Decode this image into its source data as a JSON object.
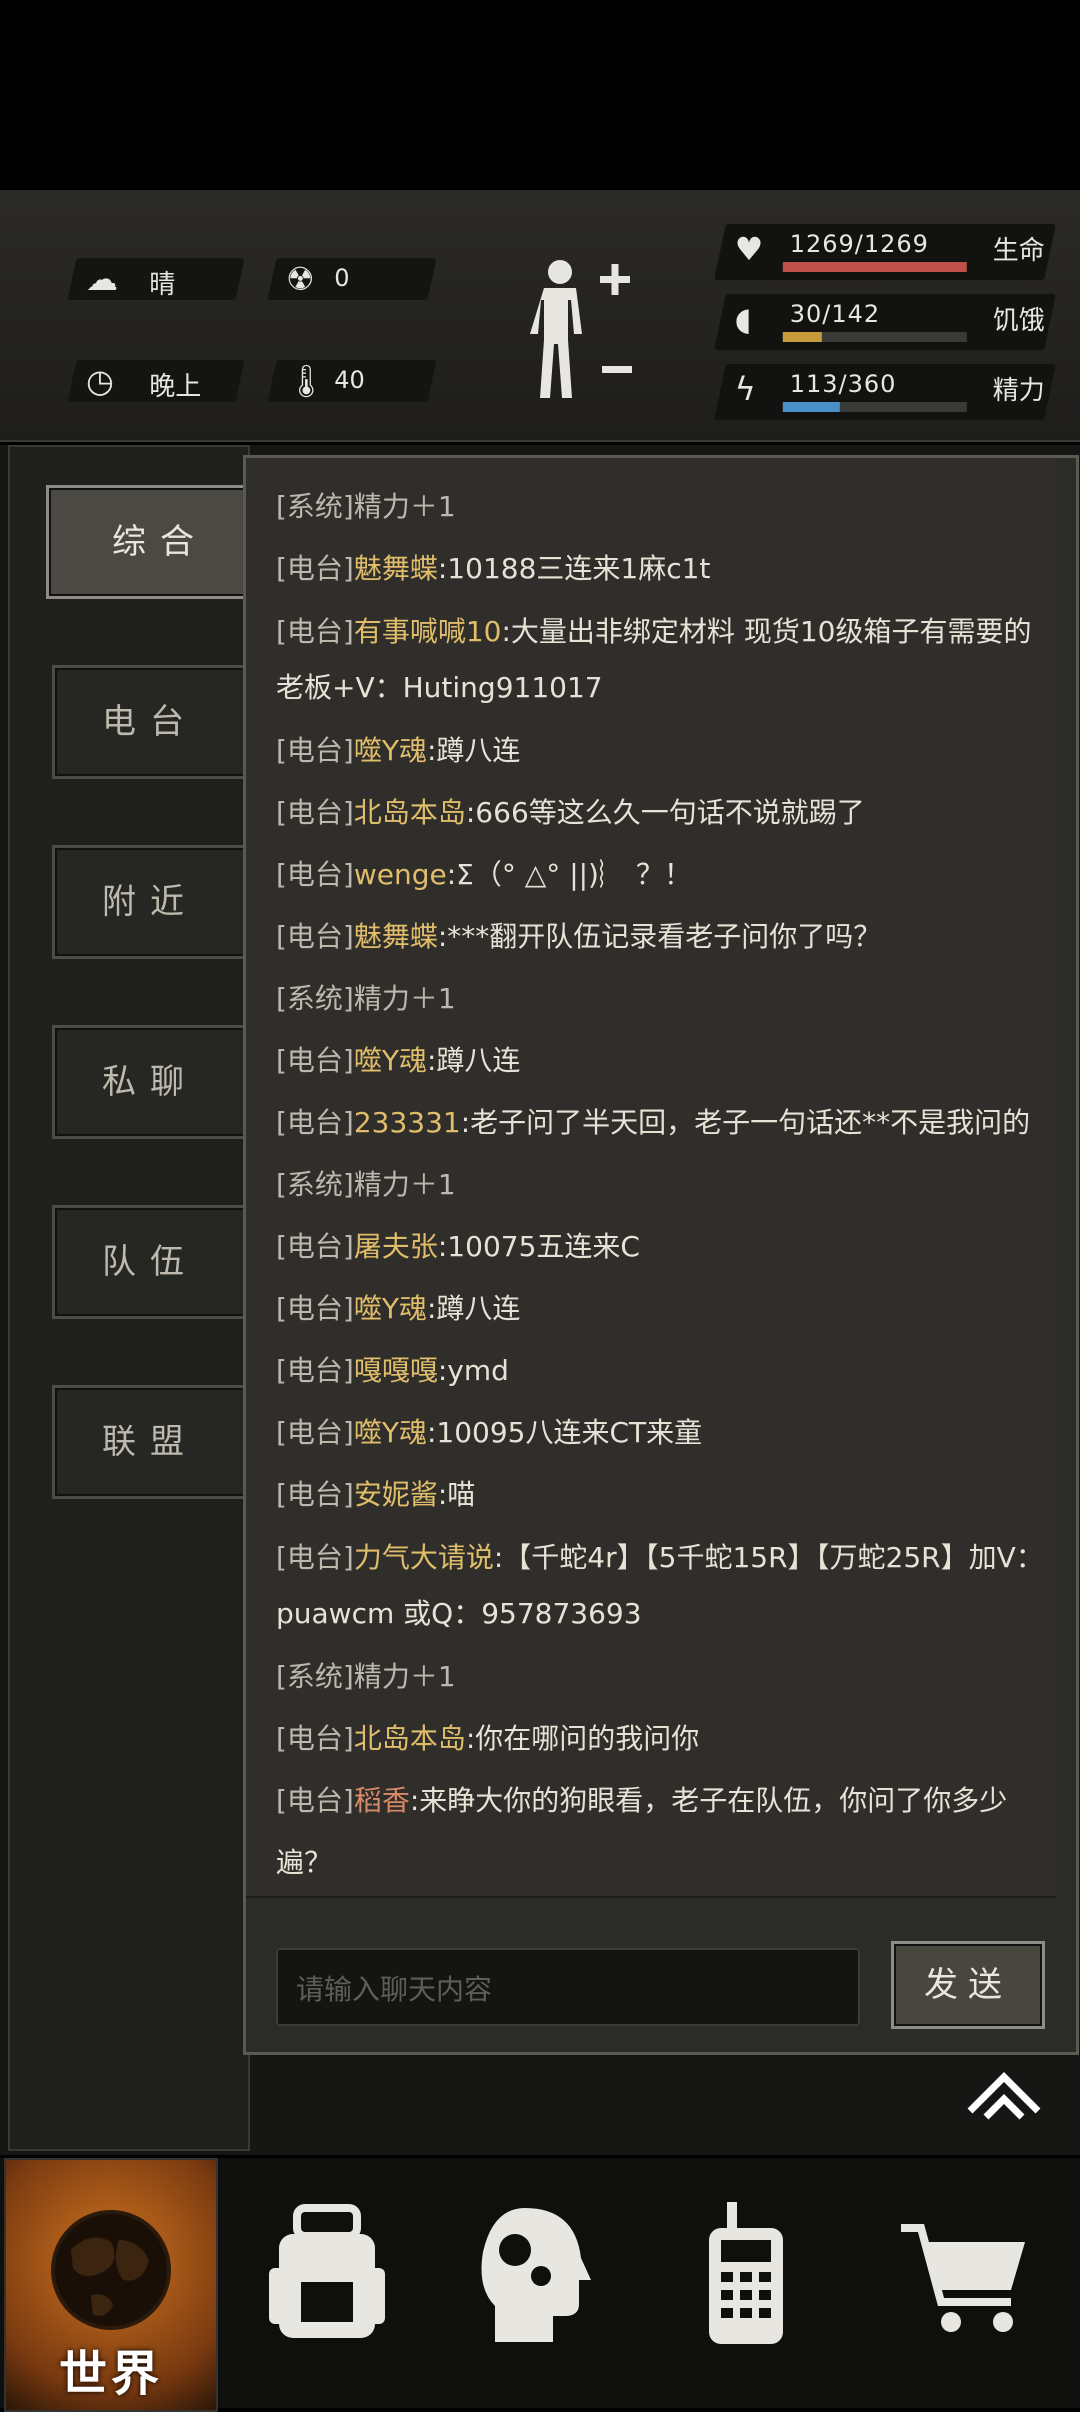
{
  "hud": {
    "weather": {
      "icon": "partly-cloudy-icon",
      "label": "晴"
    },
    "radiation": {
      "icon": "radiation-icon",
      "value": "0"
    },
    "time": {
      "icon": "clock-icon",
      "label": "晚上"
    },
    "temperature": {
      "icon": "thermometer-icon",
      "value": "40"
    },
    "stats": [
      {
        "icon": "heart-icon",
        "value": "1269/1269",
        "label": "生命",
        "fraction": 1.0,
        "color": "#c0504a"
      },
      {
        "icon": "stomach-icon",
        "value": "30/142",
        "label": "饥饿",
        "fraction": 0.21,
        "color": "#c79a3c"
      },
      {
        "icon": "head-bolt-icon",
        "value": "113/360",
        "label": "精力",
        "fraction": 0.31,
        "color": "#4a90c8"
      }
    ]
  },
  "tabs": [
    "综合",
    "电台",
    "附近",
    "私聊",
    "队伍",
    "联盟"
  ],
  "active_tab": 0,
  "messages": [
    {
      "channel": "[系统]",
      "name": "",
      "text": "精力＋1",
      "type": "sys"
    },
    {
      "channel": "[电台]",
      "name": "魅舞蝶",
      "text": ":10188三连来1麻c1t"
    },
    {
      "channel": "[电台]",
      "name": "有事喊喊10",
      "text": ":大量出非绑定材料 现货10级箱子有需要的老板+V：Huting911017"
    },
    {
      "channel": "[电台]",
      "name": "噬Y魂",
      "text": ":蹲八连"
    },
    {
      "channel": "[电台]",
      "name": "北岛本岛",
      "text": ":666等这么久一句话不说就踢了"
    },
    {
      "channel": "[电台]",
      "name": "wenge",
      "text": ":Σ（° △° ||)︴ ？！"
    },
    {
      "channel": "[电台]",
      "name": "魅舞蝶",
      "text": ":***翻开队伍记录看老子问你了吗？"
    },
    {
      "channel": "[系统]",
      "name": "",
      "text": "精力＋1",
      "type": "sys"
    },
    {
      "channel": "[电台]",
      "name": "噬Y魂",
      "text": ":蹲八连"
    },
    {
      "channel": "[电台]",
      "name": "233331",
      "text": ":老子问了半天回，老子一句话还**不是我问的"
    },
    {
      "channel": "[系统]",
      "name": "",
      "text": "精力＋1",
      "type": "sys"
    },
    {
      "channel": "[电台]",
      "name": "屠夫张",
      "text": ":10075五连来C"
    },
    {
      "channel": "[电台]",
      "name": "噬Y魂",
      "text": ":蹲八连"
    },
    {
      "channel": "[电台]",
      "name": "嘎嘎嘎",
      "text": ":ymd"
    },
    {
      "channel": "[电台]",
      "name": "噬Y魂",
      "text": ":10095八连来CT来童"
    },
    {
      "channel": "[电台]",
      "name": "安妮酱",
      "text": ":喵"
    },
    {
      "channel": "[电台]",
      "name": "力气大请说",
      "text": ":【千蛇4r】【5千蛇15R】【万蛇25R】加V：puawcm 或Q：957873693"
    },
    {
      "channel": "[系统]",
      "name": "",
      "text": "精力＋1",
      "type": "sys"
    },
    {
      "channel": "[电台]",
      "name": "北岛本岛",
      "text": ":你在哪问的我问你"
    },
    {
      "channel": "[电台]",
      "name": "稻香",
      "text": ":来睁大你的狗眼看，老子在队伍，你问了你多少遍？",
      "name_color": "red"
    }
  ],
  "input": {
    "placeholder": "请输入聊天内容"
  },
  "send_label": "发送",
  "nav": [
    {
      "icon": "globe-icon",
      "label": "世界",
      "active": true
    },
    {
      "icon": "backpack-icon",
      "label": ""
    },
    {
      "icon": "head-gears-icon",
      "label": ""
    },
    {
      "icon": "walkie-talkie-icon",
      "label": ""
    },
    {
      "icon": "cart-icon",
      "label": ""
    }
  ]
}
